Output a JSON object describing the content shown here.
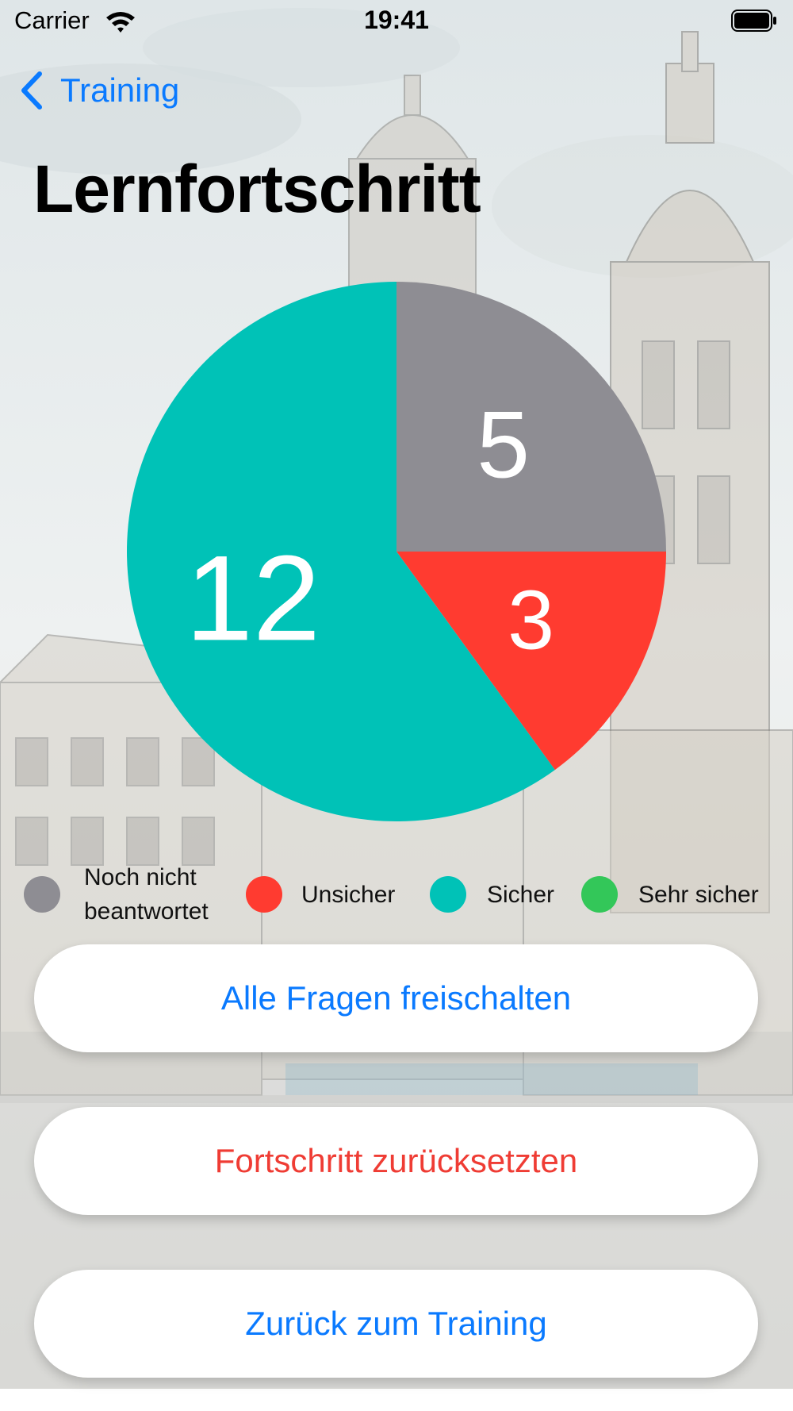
{
  "status_bar": {
    "carrier": "Carrier",
    "time": "19:41"
  },
  "nav": {
    "back_label": "Training"
  },
  "page": {
    "title": "Lernfortschritt"
  },
  "chart_data": {
    "type": "pie",
    "slices": [
      {
        "label": "Noch nicht beantwortet",
        "value": 5,
        "color": "#8e8d93"
      },
      {
        "label": "Unsicher",
        "value": 3,
        "color": "#ff3b30"
      },
      {
        "label": "Sicher",
        "value": 12,
        "color": "#00c2b7"
      },
      {
        "label": "Sehr sicher",
        "value": 0,
        "color": "#33c759"
      }
    ],
    "start_angle_deg": 0,
    "direction": "clockwise"
  },
  "legend": [
    {
      "label_line1": "Noch nicht",
      "label_line2": "beantwortet",
      "color": "#8e8d93"
    },
    {
      "label": "Unsicher",
      "color": "#ff3b30"
    },
    {
      "label": "Sicher",
      "color": "#00c2b7"
    },
    {
      "label": "Sehr sicher",
      "color": "#33c759"
    }
  ],
  "buttons": {
    "unlock_all": "Alle Fragen freischalten",
    "reset_progress": "Fortschritt zurücksetzten",
    "back_to_training": "Zurück zum Training"
  },
  "colors": {
    "accent": "#0a7aff",
    "destructive": "#ef3c34"
  }
}
